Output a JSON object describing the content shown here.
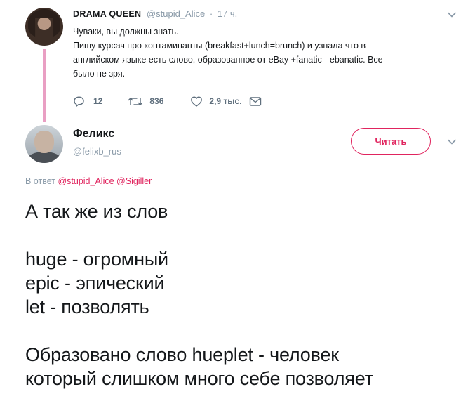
{
  "parent": {
    "name": "DRAMA QUEEN",
    "handle": "@stupid_Alice",
    "separator": "·",
    "time": "17 ч.",
    "lines": [
      "Чуваки, вы должны знать.",
      "Пишу курсач про контаминанты (breakfast+lunch=brunch) и узнала что в",
      "английском языке есть слово, образованное от eBay +fanatic - ebanatic. Все",
      "было не зря."
    ],
    "replies": "12",
    "retweets": "836",
    "likes": "2,9 тыс."
  },
  "tweet": {
    "name": "Феликс",
    "handle": "@felixb_rus",
    "follow_label": "Читать",
    "reply_prefix": "В ответ",
    "reply_mentions": [
      "@stupid_Alice",
      "@Sigiller"
    ],
    "lines": [
      "А так же из слов",
      "",
      "huge - огромный",
      "epic - эпический",
      "let - позволять",
      "",
      "Образовано слово hueplet - человек",
      "который слишком много себе позволяет"
    ]
  },
  "colors": {
    "accent": "#e0245e",
    "thread_line": "#e99fc3",
    "muted": "#8a9aa8",
    "text": "#14171a"
  },
  "icons": [
    "reply-icon",
    "retweet-icon",
    "like-icon",
    "message-icon",
    "chevron-down-icon"
  ]
}
